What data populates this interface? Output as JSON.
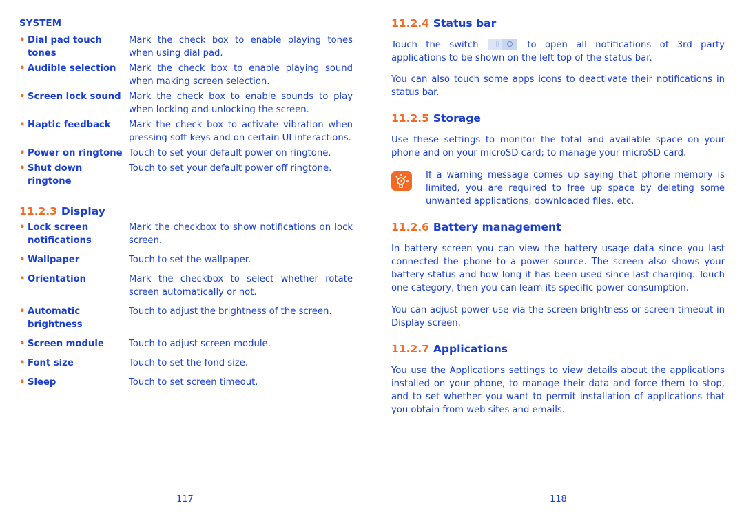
{
  "colors": {
    "text": "#1a3fd0",
    "accent": "#f26a24"
  },
  "left_page": {
    "system_title": "SYSTEM",
    "system_items": [
      {
        "term": "Dial pad touch tones",
        "desc": "Mark the check box to enable playing tones when using dial pad."
      },
      {
        "term": "Audible selection",
        "desc": "Mark the check box to enable playing sound when making screen selection."
      },
      {
        "term": "Screen lock sound",
        "desc": "Mark the check box to enable sounds to play when locking and unlocking the screen."
      },
      {
        "term": "Haptic feedback",
        "desc": "Mark the check box to activate vibration when pressing soft keys and on certain UI interactions."
      },
      {
        "term": "Power on ringtone",
        "desc": "Touch to set your default power on ringtone."
      },
      {
        "term": "Shut down ringtone",
        "desc": "Touch to set your default power off ringtone."
      }
    ],
    "display_section": {
      "number": "11.2.3",
      "title": "Display"
    },
    "display_items": [
      {
        "term": "Lock screen notifications",
        "desc": "Mark the checkbox to show notifications on lock screen."
      },
      {
        "term": "Wallpaper",
        "desc": "Touch to set the wallpaper."
      },
      {
        "term": "Orientation",
        "desc": "Mark the checkbox to select whether rotate screen automatically or not."
      },
      {
        "term": "Automatic brightness",
        "desc": "Touch to adjust the brightness of the screen."
      },
      {
        "term": "Screen module",
        "desc": "Touch to adjust screen module."
      },
      {
        "term": "Font size",
        "desc": "Touch to set the fond size."
      },
      {
        "term": "Sleep",
        "desc": "Touch to set screen timeout."
      }
    ],
    "page_number": "117"
  },
  "right_page": {
    "status_bar": {
      "number": "11.2.4",
      "title": "Status bar",
      "p1_before": "Touch the switch",
      "p1_after": "to open all notifications of 3rd party applications to be shown on the left top of the status bar.",
      "p2": "You can also touch some apps icons to deactivate their notifications in status bar."
    },
    "storage": {
      "number": "11.2.5",
      "title": "Storage",
      "p1": "Use these settings to monitor the total and available space on your phone and on your microSD card; to manage your microSD card.",
      "tip": "If a warning message comes up saying that phone memory is limited, you are required to free up space by deleting some unwanted applications, downloaded files, etc."
    },
    "battery": {
      "number": "11.2.6",
      "title": "Battery management",
      "p1": "In battery screen you can view the battery usage data since you last connected the phone to a power source. The screen also shows your battery status and how long it has been used since last charging. Touch one category, then you can learn its specific power consumption.",
      "p2": "You can adjust power use via the screen brightness or screen timeout in Display screen."
    },
    "applications": {
      "number": "11.2.7",
      "title": "Applications",
      "p1": "You use the Applications settings to view details about the applications installed on your phone, to manage their data and force them to stop, and to set whether you want to permit installation of applications that you obtain from web sites and emails."
    },
    "page_number": "118"
  }
}
